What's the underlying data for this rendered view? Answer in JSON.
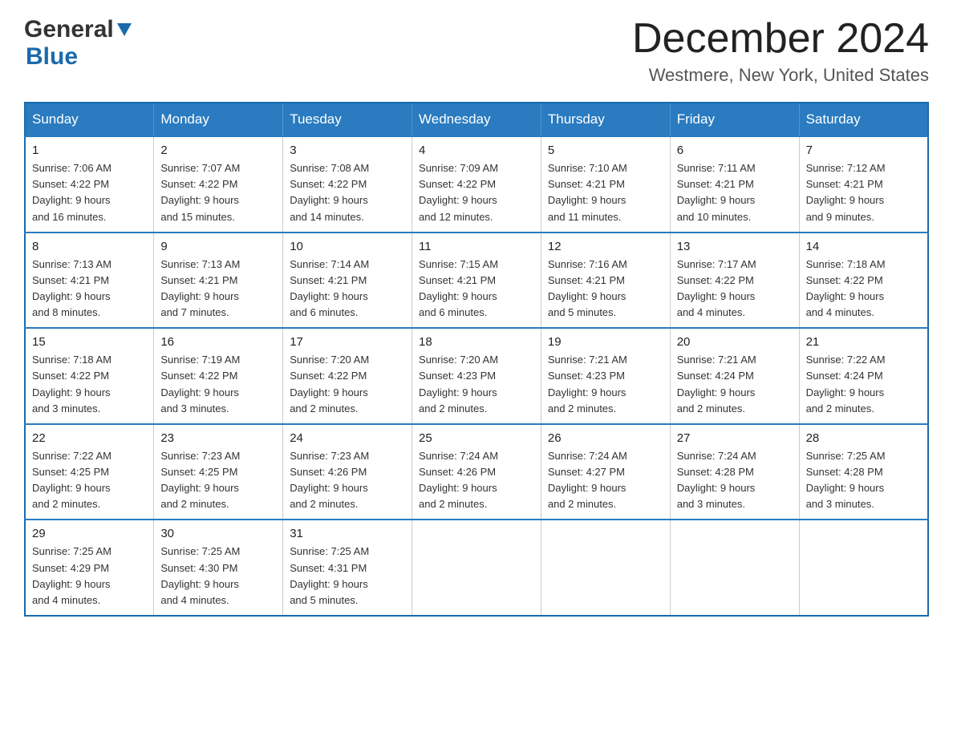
{
  "logo": {
    "general": "General",
    "blue": "Blue"
  },
  "header": {
    "month_year": "December 2024",
    "location": "Westmere, New York, United States"
  },
  "days_of_week": [
    "Sunday",
    "Monday",
    "Tuesday",
    "Wednesday",
    "Thursday",
    "Friday",
    "Saturday"
  ],
  "weeks": [
    [
      {
        "day": "1",
        "sunrise": "7:06 AM",
        "sunset": "4:22 PM",
        "daylight": "9 hours and 16 minutes."
      },
      {
        "day": "2",
        "sunrise": "7:07 AM",
        "sunset": "4:22 PM",
        "daylight": "9 hours and 15 minutes."
      },
      {
        "day": "3",
        "sunrise": "7:08 AM",
        "sunset": "4:22 PM",
        "daylight": "9 hours and 14 minutes."
      },
      {
        "day": "4",
        "sunrise": "7:09 AM",
        "sunset": "4:22 PM",
        "daylight": "9 hours and 12 minutes."
      },
      {
        "day": "5",
        "sunrise": "7:10 AM",
        "sunset": "4:21 PM",
        "daylight": "9 hours and 11 minutes."
      },
      {
        "day": "6",
        "sunrise": "7:11 AM",
        "sunset": "4:21 PM",
        "daylight": "9 hours and 10 minutes."
      },
      {
        "day": "7",
        "sunrise": "7:12 AM",
        "sunset": "4:21 PM",
        "daylight": "9 hours and 9 minutes."
      }
    ],
    [
      {
        "day": "8",
        "sunrise": "7:13 AM",
        "sunset": "4:21 PM",
        "daylight": "9 hours and 8 minutes."
      },
      {
        "day": "9",
        "sunrise": "7:13 AM",
        "sunset": "4:21 PM",
        "daylight": "9 hours and 7 minutes."
      },
      {
        "day": "10",
        "sunrise": "7:14 AM",
        "sunset": "4:21 PM",
        "daylight": "9 hours and 6 minutes."
      },
      {
        "day": "11",
        "sunrise": "7:15 AM",
        "sunset": "4:21 PM",
        "daylight": "9 hours and 6 minutes."
      },
      {
        "day": "12",
        "sunrise": "7:16 AM",
        "sunset": "4:21 PM",
        "daylight": "9 hours and 5 minutes."
      },
      {
        "day": "13",
        "sunrise": "7:17 AM",
        "sunset": "4:22 PM",
        "daylight": "9 hours and 4 minutes."
      },
      {
        "day": "14",
        "sunrise": "7:18 AM",
        "sunset": "4:22 PM",
        "daylight": "9 hours and 4 minutes."
      }
    ],
    [
      {
        "day": "15",
        "sunrise": "7:18 AM",
        "sunset": "4:22 PM",
        "daylight": "9 hours and 3 minutes."
      },
      {
        "day": "16",
        "sunrise": "7:19 AM",
        "sunset": "4:22 PM",
        "daylight": "9 hours and 3 minutes."
      },
      {
        "day": "17",
        "sunrise": "7:20 AM",
        "sunset": "4:22 PM",
        "daylight": "9 hours and 2 minutes."
      },
      {
        "day": "18",
        "sunrise": "7:20 AM",
        "sunset": "4:23 PM",
        "daylight": "9 hours and 2 minutes."
      },
      {
        "day": "19",
        "sunrise": "7:21 AM",
        "sunset": "4:23 PM",
        "daylight": "9 hours and 2 minutes."
      },
      {
        "day": "20",
        "sunrise": "7:21 AM",
        "sunset": "4:24 PM",
        "daylight": "9 hours and 2 minutes."
      },
      {
        "day": "21",
        "sunrise": "7:22 AM",
        "sunset": "4:24 PM",
        "daylight": "9 hours and 2 minutes."
      }
    ],
    [
      {
        "day": "22",
        "sunrise": "7:22 AM",
        "sunset": "4:25 PM",
        "daylight": "9 hours and 2 minutes."
      },
      {
        "day": "23",
        "sunrise": "7:23 AM",
        "sunset": "4:25 PM",
        "daylight": "9 hours and 2 minutes."
      },
      {
        "day": "24",
        "sunrise": "7:23 AM",
        "sunset": "4:26 PM",
        "daylight": "9 hours and 2 minutes."
      },
      {
        "day": "25",
        "sunrise": "7:24 AM",
        "sunset": "4:26 PM",
        "daylight": "9 hours and 2 minutes."
      },
      {
        "day": "26",
        "sunrise": "7:24 AM",
        "sunset": "4:27 PM",
        "daylight": "9 hours and 2 minutes."
      },
      {
        "day": "27",
        "sunrise": "7:24 AM",
        "sunset": "4:28 PM",
        "daylight": "9 hours and 3 minutes."
      },
      {
        "day": "28",
        "sunrise": "7:25 AM",
        "sunset": "4:28 PM",
        "daylight": "9 hours and 3 minutes."
      }
    ],
    [
      {
        "day": "29",
        "sunrise": "7:25 AM",
        "sunset": "4:29 PM",
        "daylight": "9 hours and 4 minutes."
      },
      {
        "day": "30",
        "sunrise": "7:25 AM",
        "sunset": "4:30 PM",
        "daylight": "9 hours and 4 minutes."
      },
      {
        "day": "31",
        "sunrise": "7:25 AM",
        "sunset": "4:31 PM",
        "daylight": "9 hours and 5 minutes."
      },
      null,
      null,
      null,
      null
    ]
  ],
  "labels": {
    "sunrise": "Sunrise: ",
    "sunset": "Sunset: ",
    "daylight": "Daylight: "
  }
}
